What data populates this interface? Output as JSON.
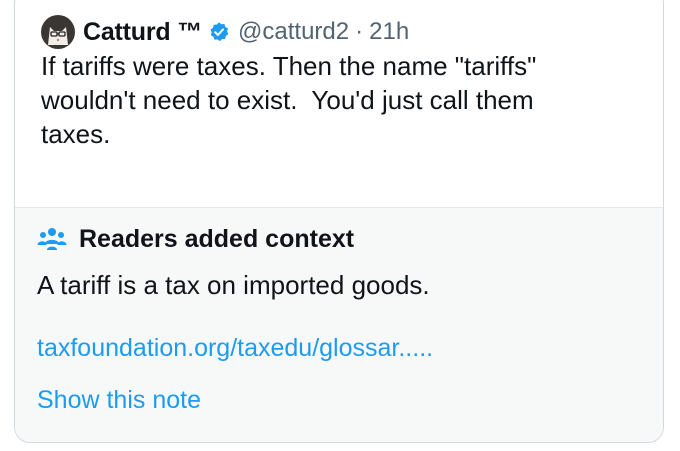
{
  "tweet": {
    "author_name": "Catturd ™",
    "handle": "@catturd2",
    "separator": "·",
    "time": "21h",
    "text": "If tariffs were taxes. Then the name \"tariffs\"\nwouldn't need to exist.  You'd just call them\ntaxes.",
    "icons": {
      "avatar": "cat-avatar",
      "verified": "verified-badge-icon"
    }
  },
  "community_note": {
    "title": "Readers added context",
    "body": "A tariff is a tax on imported goods.",
    "link": "taxfoundation.org/taxedu/glossar.....",
    "show_note_label": "Show this note",
    "icon": "people-icon"
  },
  "colors": {
    "link": "#1d9bf0",
    "secondary_text": "#536471",
    "note_background": "#f7f9f9",
    "border": "#cfd9de",
    "verified": "#1d9bf0"
  }
}
